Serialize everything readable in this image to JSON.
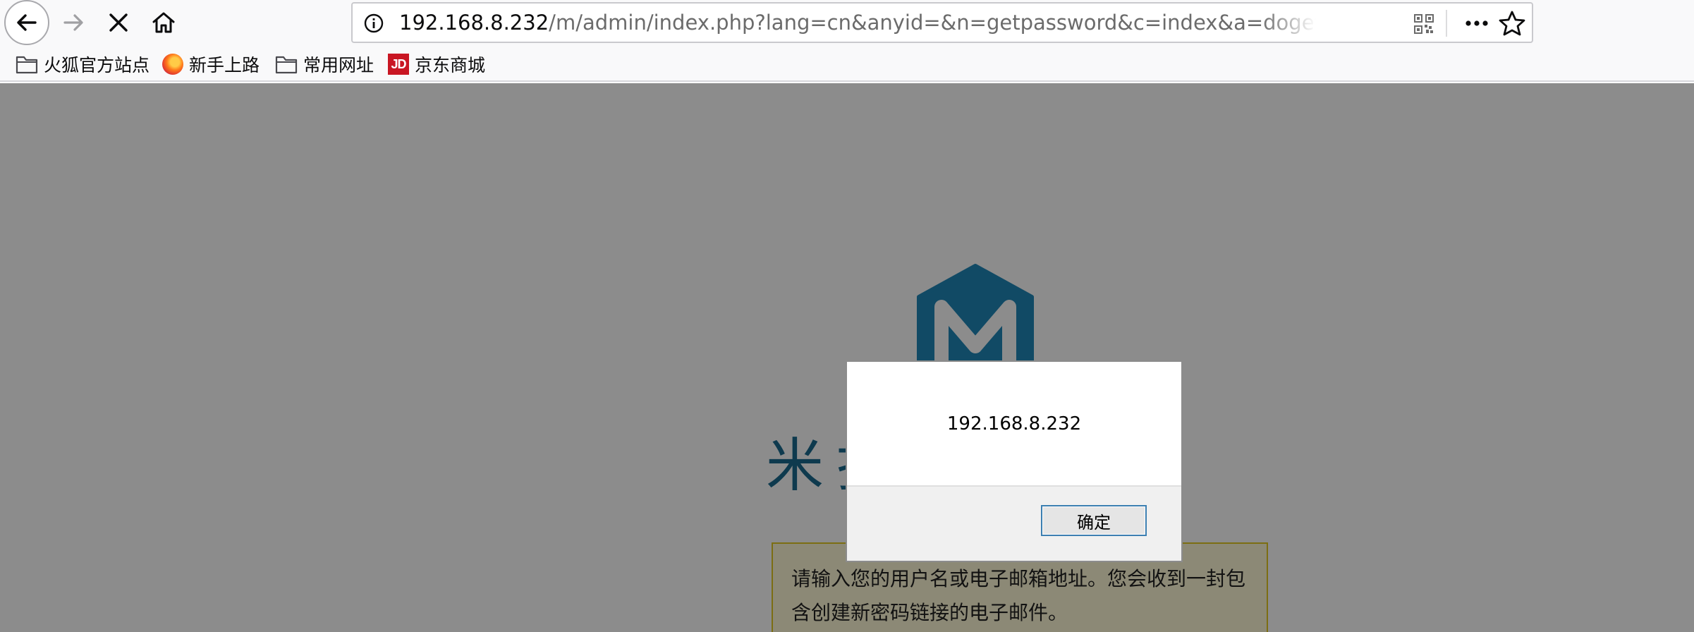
{
  "browser": {
    "url_host": "192.168.8.232",
    "url_path": "/m/admin/index.php?lang=cn&anyid=&n=getpassword&c=index&a=dogetpassword&lang=cn",
    "icons": {
      "back": "back-arrow-icon",
      "forward": "forward-arrow-icon",
      "stop": "stop-x-icon",
      "home": "home-icon",
      "info": "info-icon",
      "qr": "qr-code-icon",
      "more": "more-dots-icon",
      "bookmark": "star-icon"
    }
  },
  "bookmarks": [
    {
      "label": "火狐官方站点",
      "icon": "folder-icon"
    },
    {
      "label": "新手上路",
      "icon": "firefox-icon"
    },
    {
      "label": "常用网址",
      "icon": "folder-icon"
    },
    {
      "label": "京东商城",
      "icon": "jd-icon",
      "icon_text": "JD"
    }
  ],
  "page": {
    "logo_text": "米拓企业建站",
    "notice": "请输入您的用户名或电子邮箱地址。您会收到一封包含创建新密码链接的电子邮件。"
  },
  "dialog": {
    "message": "192.168.8.232",
    "ok_label": "确定"
  },
  "colors": {
    "accent": "#1b6a8f",
    "notice_bg": "#fff9d7",
    "notice_border": "#e2c822",
    "overlay": "rgba(0,0,0,0.45)"
  }
}
